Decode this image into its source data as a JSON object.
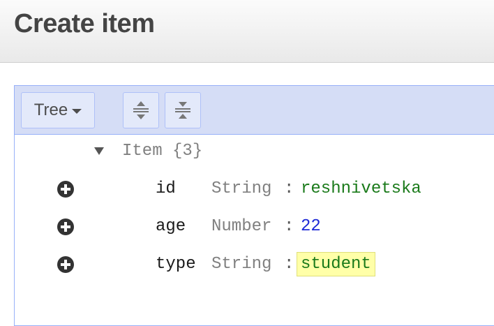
{
  "header": {
    "title": "Create item"
  },
  "toolbar": {
    "mode_label": "Tree",
    "expand_icon": "expand-all-icon",
    "collapse_icon": "collapse-all-icon"
  },
  "tree": {
    "root_label": "Item {3}",
    "separator": ":",
    "fields": [
      {
        "name": "id",
        "type": "String",
        "value": "reshnivetska",
        "value_kind": "string"
      },
      {
        "name": "age",
        "type": "Number",
        "value": "22",
        "value_kind": "number"
      },
      {
        "name": "type",
        "type": "String",
        "value": "student",
        "value_kind": "string",
        "highlighted": true
      }
    ]
  },
  "colors": {
    "string_value": "#1a7a1a",
    "number_value": "#1f2bd6",
    "menu_background": "#d5ddf6",
    "highlight": "#ffffa8"
  }
}
